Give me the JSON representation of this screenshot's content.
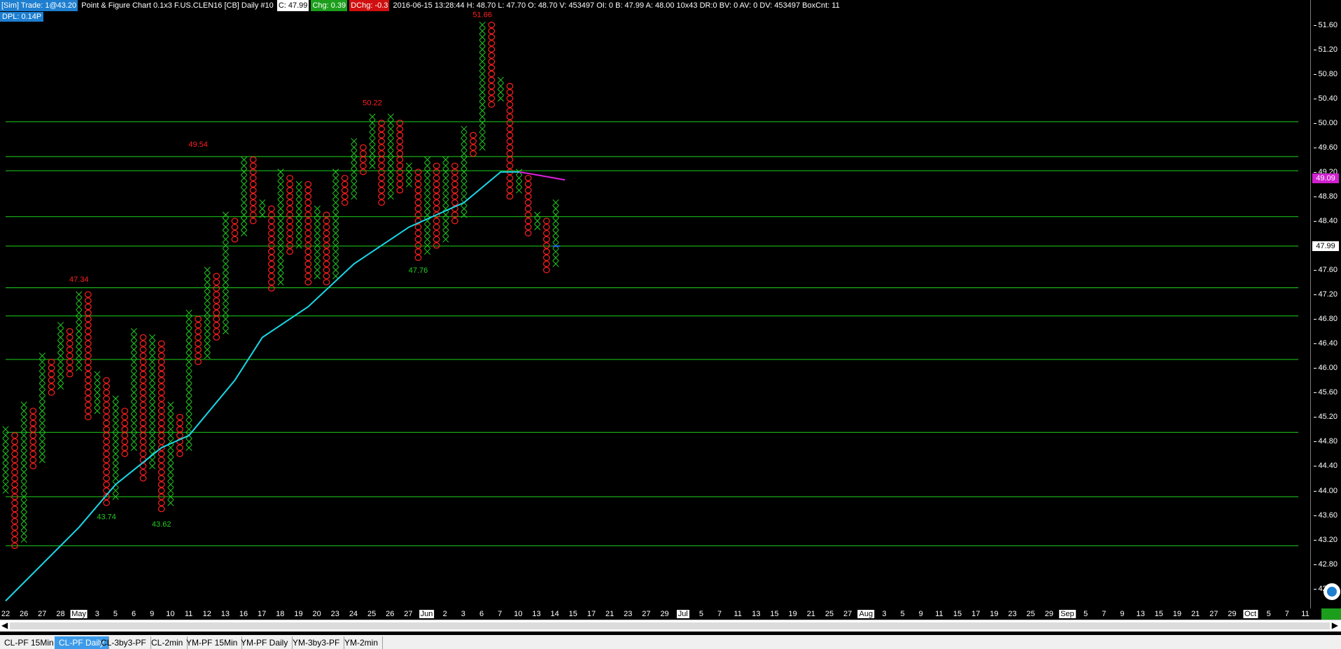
{
  "header": {
    "sim_badge": "[Sim]  Trade: 1@43.20",
    "chart_title": "Point & Figure Chart 0.1x3 F.US.CLEN16 [CB]  Daily  #10",
    "close_label": "C: 47.99",
    "chg_label": "Chg: 0.39",
    "dchg_label": "DChg: -0.3",
    "bar_info": "2016-06-15 13:28:44  H: 48.70  L: 47.70  O: 48.70  V: 453497  OI: 0  B: 47.99  A: 48.00  10x43  DR:0  BV: 0  AV: 0  DV: 453497  BoxCnt: 11"
  },
  "dpl_label": "DPL: 0.14P",
  "colors": {
    "x_mark": "#22cc22",
    "o_mark": "#ff2020",
    "support_line": "#1ed21e",
    "moving_avg": "#19d8e8",
    "ma_tail": "#e020e0",
    "current_price_bg": "#ffffff",
    "ma_price_bg": "#d020d0"
  },
  "price_axis": {
    "ticks": [
      "51.60",
      "51.20",
      "50.80",
      "50.40",
      "50.00",
      "49.60",
      "49.20",
      "48.80",
      "48.40",
      "48.00",
      "47.60",
      "47.20",
      "46.80",
      "46.40",
      "46.00",
      "45.60",
      "45.20",
      "44.80",
      "44.40",
      "44.00",
      "43.60",
      "43.20",
      "42.80",
      "42.40"
    ],
    "current_price": "47.99",
    "ma_price": "49.09"
  },
  "date_axis": {
    "labels": [
      "22",
      "26",
      "27",
      "28",
      "May",
      "3",
      "5",
      "6",
      "9",
      "10",
      "11",
      "12",
      "13",
      "16",
      "17",
      "18",
      "19",
      "20",
      "23",
      "24",
      "25",
      "26",
      "27",
      "Jun",
      "2",
      "3",
      "6",
      "7",
      "10",
      "13",
      "14",
      "15",
      "17",
      "21",
      "23",
      "27",
      "29",
      "Jul",
      "5",
      "7",
      "11",
      "13",
      "15",
      "19",
      "21",
      "25",
      "27",
      "Aug",
      "3",
      "5",
      "9",
      "11",
      "15",
      "17",
      "19",
      "23",
      "25",
      "29",
      "Sep",
      "5",
      "7",
      "9",
      "13",
      "15",
      "19",
      "21",
      "27",
      "29",
      "Oct",
      "5",
      "7",
      "11"
    ],
    "month_labels": [
      "May",
      "Jun",
      "Jul",
      "Aug",
      "Sep",
      "Oct"
    ]
  },
  "annotations": {
    "high_labels": [
      "47.34",
      "49.54",
      "50.22",
      "51.66"
    ],
    "low_labels": [
      "43.74",
      "43.62",
      "47.76"
    ]
  },
  "chart_data": {
    "type": "point-and-figure",
    "symbol": "F.US.CLEN16",
    "box_size": 0.1,
    "reversal": 3,
    "columns": [
      {
        "type": "X",
        "low": 44.0,
        "high": 45.0
      },
      {
        "type": "O",
        "high": 44.9,
        "low": 43.1
      },
      {
        "type": "X",
        "low": 43.2,
        "high": 45.4
      },
      {
        "type": "O",
        "high": 45.3,
        "low": 44.4
      },
      {
        "type": "X",
        "low": 44.5,
        "high": 46.2
      },
      {
        "type": "O",
        "high": 46.1,
        "low": 45.6
      },
      {
        "type": "X",
        "low": 45.7,
        "high": 46.7
      },
      {
        "type": "O",
        "high": 46.6,
        "low": 45.9
      },
      {
        "type": "X",
        "low": 46.0,
        "high": 47.2
      },
      {
        "type": "O",
        "high": 47.2,
        "low": 45.2
      },
      {
        "type": "X",
        "low": 45.3,
        "high": 45.9
      },
      {
        "type": "O",
        "high": 45.8,
        "low": 43.8
      },
      {
        "type": "X",
        "low": 43.9,
        "high": 45.5
      },
      {
        "type": "O",
        "high": 45.3,
        "low": 44.6
      },
      {
        "type": "X",
        "low": 44.7,
        "high": 46.6
      },
      {
        "type": "O",
        "high": 46.5,
        "low": 44.2
      },
      {
        "type": "X",
        "low": 44.4,
        "high": 46.5
      },
      {
        "type": "O",
        "high": 46.4,
        "low": 43.7
      },
      {
        "type": "X",
        "low": 43.8,
        "high": 45.4
      },
      {
        "type": "O",
        "high": 45.2,
        "low": 44.6
      },
      {
        "type": "X",
        "low": 44.7,
        "high": 46.9
      },
      {
        "type": "O",
        "high": 46.8,
        "low": 46.1
      },
      {
        "type": "X",
        "low": 46.2,
        "high": 47.6
      },
      {
        "type": "O",
        "high": 47.5,
        "low": 46.5
      },
      {
        "type": "X",
        "low": 46.6,
        "high": 48.5
      },
      {
        "type": "O",
        "high": 48.4,
        "low": 48.1
      },
      {
        "type": "X",
        "low": 48.2,
        "high": 49.4
      },
      {
        "type": "O",
        "high": 49.4,
        "low": 48.4
      },
      {
        "type": "X",
        "low": 48.5,
        "high": 48.7
      },
      {
        "type": "O",
        "high": 48.6,
        "low": 47.3
      },
      {
        "type": "X",
        "low": 47.4,
        "high": 49.2
      },
      {
        "type": "O",
        "high": 49.1,
        "low": 47.9
      },
      {
        "type": "X",
        "low": 48.0,
        "high": 49.0
      },
      {
        "type": "O",
        "high": 49.0,
        "low": 47.4
      },
      {
        "type": "X",
        "low": 47.5,
        "high": 48.6
      },
      {
        "type": "O",
        "high": 48.5,
        "low": 47.4
      },
      {
        "type": "X",
        "low": 47.5,
        "high": 49.2
      },
      {
        "type": "O",
        "high": 49.1,
        "low": 48.7
      },
      {
        "type": "X",
        "low": 48.8,
        "high": 49.7
      },
      {
        "type": "O",
        "high": 49.6,
        "low": 49.2
      },
      {
        "type": "X",
        "low": 49.3,
        "high": 50.1
      },
      {
        "type": "O",
        "high": 50.0,
        "low": 48.7
      },
      {
        "type": "X",
        "low": 48.8,
        "high": 50.1
      },
      {
        "type": "O",
        "high": 50.0,
        "low": 48.9
      },
      {
        "type": "X",
        "low": 49.0,
        "high": 49.3
      },
      {
        "type": "O",
        "high": 49.2,
        "low": 47.8
      },
      {
        "type": "X",
        "low": 47.9,
        "high": 49.4
      },
      {
        "type": "O",
        "high": 49.3,
        "low": 48.0
      },
      {
        "type": "X",
        "low": 48.1,
        "high": 49.4
      },
      {
        "type": "O",
        "high": 49.3,
        "low": 48.4
      },
      {
        "type": "X",
        "low": 48.5,
        "high": 49.9
      },
      {
        "type": "O",
        "high": 49.8,
        "low": 49.5
      },
      {
        "type": "X",
        "low": 49.6,
        "high": 51.6
      },
      {
        "type": "O",
        "high": 51.6,
        "low": 50.3
      },
      {
        "type": "X",
        "low": 50.4,
        "high": 50.7
      },
      {
        "type": "O",
        "high": 50.6,
        "low": 48.8
      },
      {
        "type": "X",
        "low": 48.9,
        "high": 49.2
      },
      {
        "type": "O",
        "high": 49.1,
        "low": 48.2
      },
      {
        "type": "X",
        "low": 48.3,
        "high": 48.5
      },
      {
        "type": "O",
        "high": 48.4,
        "low": 47.6
      },
      {
        "type": "X",
        "low": 47.7,
        "high": 48.7
      }
    ],
    "moving_average_anchor": [
      {
        "col": 0,
        "price": 42.2
      },
      {
        "col": 8,
        "price": 43.4
      },
      {
        "col": 12,
        "price": 44.1
      },
      {
        "col": 17,
        "price": 44.7
      },
      {
        "col": 20,
        "price": 44.9
      },
      {
        "col": 25,
        "price": 45.8
      },
      {
        "col": 28,
        "price": 46.5
      },
      {
        "col": 33,
        "price": 47.0
      },
      {
        "col": 38,
        "price": 47.7
      },
      {
        "col": 44,
        "price": 48.3
      },
      {
        "col": 50,
        "price": 48.7
      },
      {
        "col": 54,
        "price": 49.2
      },
      {
        "col": 56,
        "price": 49.2
      }
    ],
    "ma_tail_anchor": [
      {
        "col": 56,
        "price": 49.2
      },
      {
        "col": 58,
        "price": 49.15
      },
      {
        "col": 61,
        "price": 49.07
      }
    ],
    "horizontal_levels": [
      50.02,
      49.45,
      49.22,
      48.47,
      47.99,
      47.31,
      46.85,
      46.14,
      44.95,
      43.9,
      43.1
    ],
    "ylim": [
      42.1,
      51.8
    ]
  },
  "tabs": [
    "CL-PF 15Min",
    "CL-PF Daily",
    "CL-3by3-PF",
    "CL-2min",
    "YM-PF 15Min",
    "YM-PF Daily",
    "YM-3by3-PF",
    "YM-2min"
  ],
  "active_tab": "CL-PF Daily"
}
